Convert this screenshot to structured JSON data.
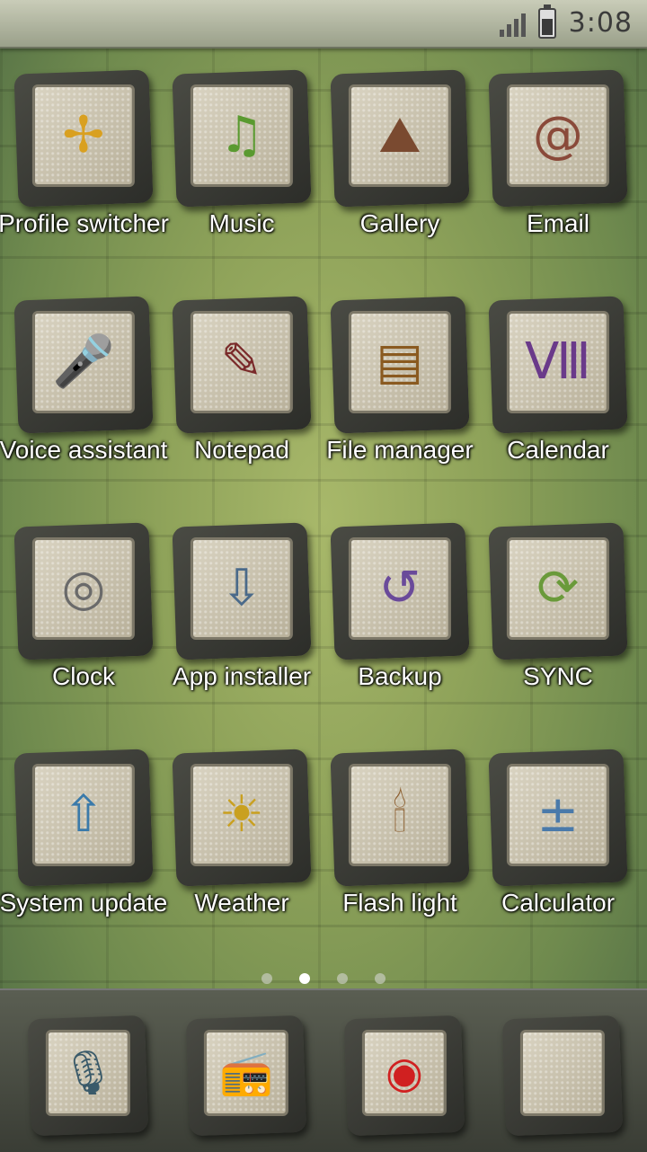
{
  "status_bar": {
    "time": "3:08",
    "signal_icon": "signal-strength-icon",
    "battery_icon": "battery-icon"
  },
  "apps": [
    {
      "label": "Profile switcher",
      "icon": "pinwheel-icon",
      "glyph": "✢",
      "color": "#d9a020"
    },
    {
      "label": "Music",
      "icon": "music-note-icon",
      "glyph": "♫",
      "color": "#5a9a30"
    },
    {
      "label": "Gallery",
      "icon": "landscape-icon",
      "glyph": "⛰",
      "color": "#7a4a30"
    },
    {
      "label": "Email",
      "icon": "email-icon",
      "glyph": "@",
      "color": "#8a4a3a"
    },
    {
      "label": "Voice assistant",
      "icon": "microphone-icon",
      "glyph": "🎤",
      "color": "#2a4a5a"
    },
    {
      "label": "Notepad",
      "icon": "notepad-icon",
      "glyph": "✎",
      "color": "#7a2a2a"
    },
    {
      "label": "File manager",
      "icon": "folder-icon",
      "glyph": "▤",
      "color": "#8a5a20"
    },
    {
      "label": "Calendar",
      "icon": "calendar-icon",
      "glyph": "Ⅷ",
      "color": "#6a3a8a"
    },
    {
      "label": "Clock",
      "icon": "clock-icon",
      "glyph": "◎",
      "color": "#6a6a6a"
    },
    {
      "label": "App installer",
      "icon": "app-installer-icon",
      "glyph": "⇩",
      "color": "#4a6a8a"
    },
    {
      "label": "Backup",
      "icon": "backup-icon",
      "glyph": "↺",
      "color": "#6a4a9a"
    },
    {
      "label": "SYNC",
      "icon": "sync-icon",
      "glyph": "⟳",
      "color": "#6a9a3a"
    },
    {
      "label": "System update",
      "icon": "system-update-icon",
      "glyph": "⇧",
      "color": "#3a7aaa"
    },
    {
      "label": "Weather",
      "icon": "sun-icon",
      "glyph": "☀",
      "color": "#c9a020"
    },
    {
      "label": "Flash light",
      "icon": "candle-icon",
      "glyph": "🕯",
      "color": "#8a5a2a"
    },
    {
      "label": "Calculator",
      "icon": "calculator-icon",
      "glyph": "±",
      "color": "#4a7aaa"
    }
  ],
  "page_indicator": {
    "count": 4,
    "active": 1
  },
  "dock": [
    {
      "icon": "microphone-icon",
      "glyph": "🎙",
      "color": "#3a5a6a"
    },
    {
      "icon": "radio-icon",
      "glyph": "📻",
      "color": "#7a6a30"
    },
    {
      "icon": "weibo-icon",
      "glyph": "◉",
      "color": "#d02020"
    },
    {
      "icon": "blank-tile-icon",
      "glyph": "",
      "color": "#888"
    }
  ]
}
